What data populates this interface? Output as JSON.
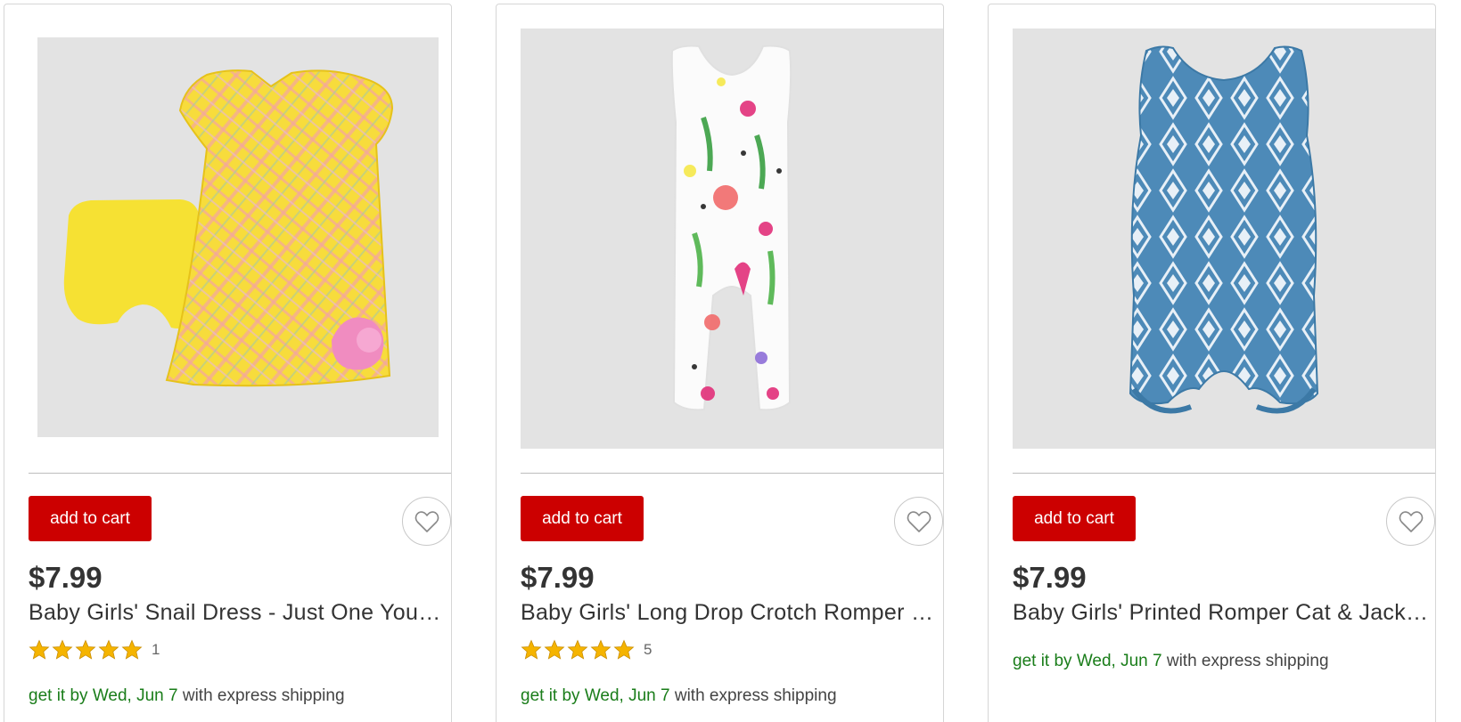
{
  "products": [
    {
      "button_label": "add to cart",
      "price": "$7.99",
      "title": "Baby Girls' Snail Dress - Just One You…",
      "rating_stars": 5,
      "review_count": "1",
      "shipping_date": "get it by Wed, Jun 7",
      "shipping_method": "with express shipping"
    },
    {
      "button_label": "add to cart",
      "price": "$7.99",
      "title": "Baby Girls' Long Drop Crotch Romper …",
      "rating_stars": 5,
      "review_count": "5",
      "shipping_date": "get it by Wed, Jun 7",
      "shipping_method": "with express shipping"
    },
    {
      "button_label": "add to cart",
      "price": "$7.99",
      "title": "Baby Girls' Printed Romper Cat & Jack…",
      "shipping_date": "get it by Wed, Jun 7",
      "shipping_method": "with express shipping"
    }
  ],
  "colors": {
    "brand_red": "#cc0000",
    "shipping_green": "#1a7d1a",
    "star_gold": "#f5b400",
    "image_bg": "#e3e3e3"
  },
  "icons": {
    "favorite": "heart-outline-icon",
    "rating": "star-icon"
  }
}
